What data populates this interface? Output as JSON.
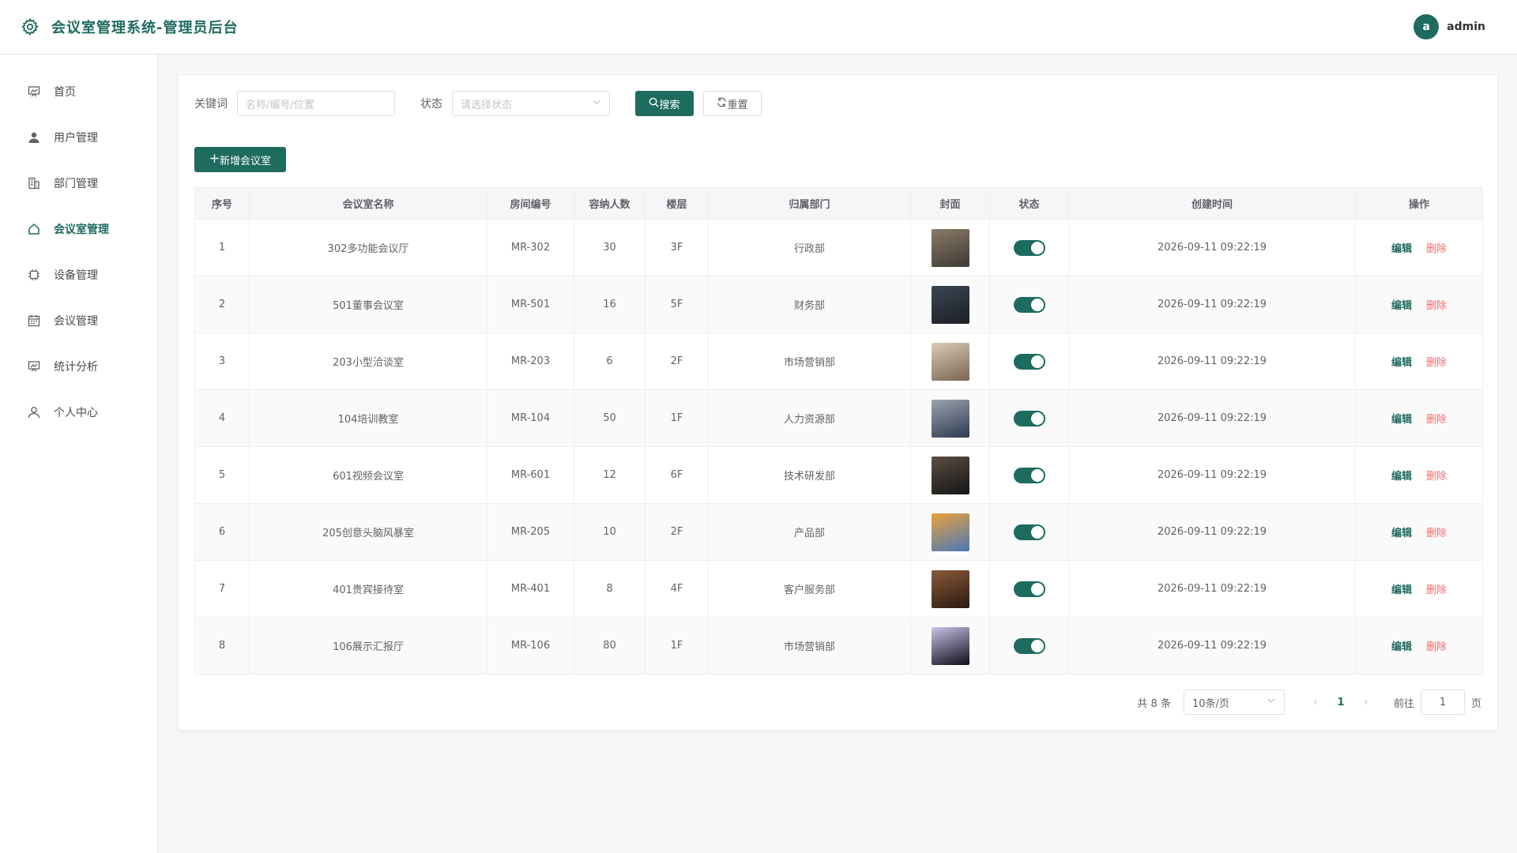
{
  "header": {
    "title": "会议室管理系统-管理员后台",
    "user": {
      "avatar_letter": "a",
      "name": "admin"
    }
  },
  "sidebar": {
    "items": [
      {
        "label": "首页",
        "icon": "chart-board-icon",
        "active": false
      },
      {
        "label": "用户管理",
        "icon": "user-icon",
        "active": false
      },
      {
        "label": "部门管理",
        "icon": "building-icon",
        "active": false
      },
      {
        "label": "会议室管理",
        "icon": "home-icon",
        "active": true
      },
      {
        "label": "设备管理",
        "icon": "cpu-icon",
        "active": false
      },
      {
        "label": "会议管理",
        "icon": "calendar-icon",
        "active": false
      },
      {
        "label": "统计分析",
        "icon": "chart-board-icon",
        "active": false
      },
      {
        "label": "个人中心",
        "icon": "user-outline-icon",
        "active": false
      }
    ]
  },
  "filters": {
    "keyword_label": "关键词",
    "keyword_placeholder": "名称/编号/位置",
    "status_label": "状态",
    "status_placeholder": "请选择状态",
    "search_label": "搜索",
    "reset_label": "重置"
  },
  "add_button_label": "新增会议室",
  "table": {
    "columns": [
      "序号",
      "会议室名称",
      "房间编号",
      "容纳人数",
      "楼层",
      "归属部门",
      "封面",
      "状态",
      "创建时间",
      "操作"
    ],
    "edit_label": "编辑",
    "delete_label": "删除",
    "rows": [
      {
        "index": "1",
        "name": "302多功能会议厅",
        "code": "MR-302",
        "capacity": "30",
        "floor": "3F",
        "dept": "行政部",
        "created": "2026-09-11 09:22:19",
        "status_on": true,
        "cover_colors": [
          "#8a7a66",
          "#3d3a36"
        ]
      },
      {
        "index": "2",
        "name": "501董事会议室",
        "code": "MR-501",
        "capacity": "16",
        "floor": "5F",
        "dept": "财务部",
        "created": "2026-09-11 09:22:19",
        "status_on": true,
        "cover_colors": [
          "#3b4654",
          "#1c1f24"
        ]
      },
      {
        "index": "3",
        "name": "203小型洽谈室",
        "code": "MR-203",
        "capacity": "6",
        "floor": "2F",
        "dept": "市场营销部",
        "created": "2026-09-11 09:22:19",
        "status_on": true,
        "cover_colors": [
          "#d8cbb6",
          "#7a6550"
        ]
      },
      {
        "index": "4",
        "name": "104培训教室",
        "code": "MR-104",
        "capacity": "50",
        "floor": "1F",
        "dept": "人力资源部",
        "created": "2026-09-11 09:22:19",
        "status_on": true,
        "cover_colors": [
          "#9aa3ad",
          "#2f3a52"
        ]
      },
      {
        "index": "5",
        "name": "601视频会议室",
        "code": "MR-601",
        "capacity": "12",
        "floor": "6F",
        "dept": "技术研发部",
        "created": "2026-09-11 09:22:19",
        "status_on": true,
        "cover_colors": [
          "#5a4e42",
          "#151515"
        ]
      },
      {
        "index": "6",
        "name": "205创意头脑风暴室",
        "code": "MR-205",
        "capacity": "10",
        "floor": "2F",
        "dept": "产品部",
        "created": "2026-09-11 09:22:19",
        "status_on": true,
        "cover_colors": [
          "#e8a23c",
          "#4a78b8"
        ]
      },
      {
        "index": "7",
        "name": "401贵宾接待室",
        "code": "MR-401",
        "capacity": "8",
        "floor": "4F",
        "dept": "客户服务部",
        "created": "2026-09-11 09:22:19",
        "status_on": true,
        "cover_colors": [
          "#8a5a36",
          "#2a1a12"
        ]
      },
      {
        "index": "8",
        "name": "106展示汇报厅",
        "code": "MR-106",
        "capacity": "80",
        "floor": "1F",
        "dept": "市场营销部",
        "created": "2026-09-11 09:22:19",
        "status_on": true,
        "cover_colors": [
          "#c9c2e8",
          "#0d0d18"
        ]
      }
    ]
  },
  "pagination": {
    "total_text": "共 8 条",
    "page_size": "10条/页",
    "current_page": "1",
    "goto_label": "前往",
    "goto_value": "1",
    "page_suffix": "页"
  },
  "colors": {
    "primary": "#1e6b60",
    "danger": "#f56c6c"
  }
}
